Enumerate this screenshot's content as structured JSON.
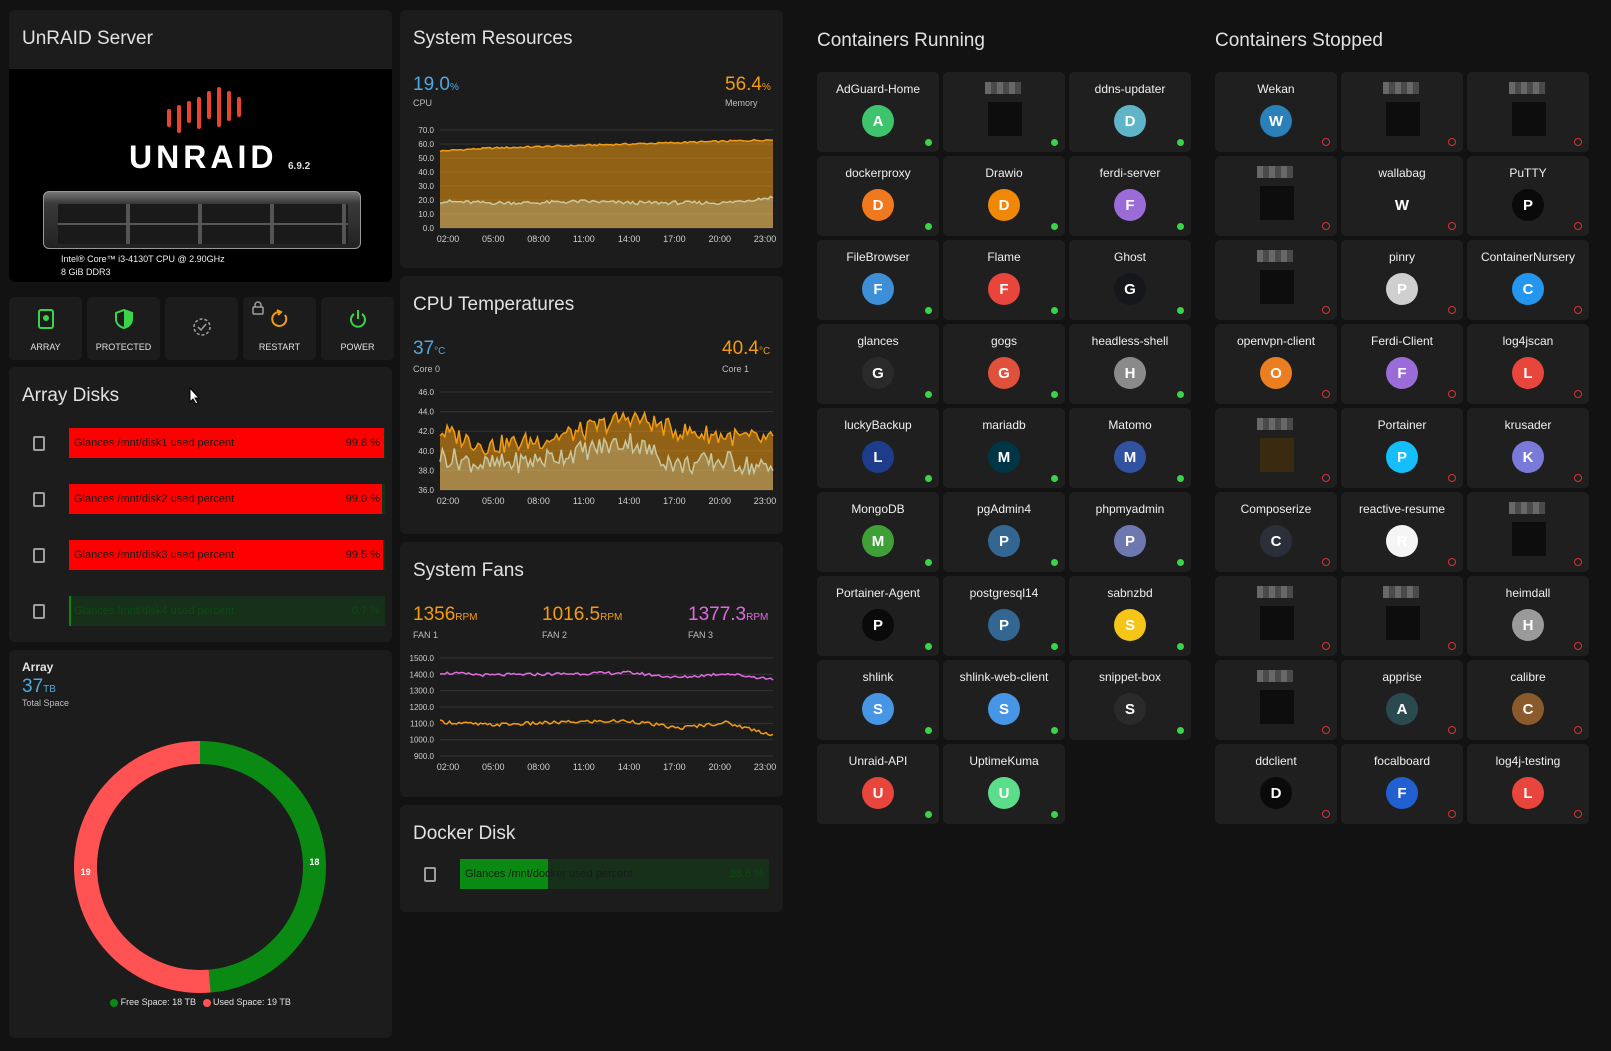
{
  "server": {
    "title": "UnRAID Server",
    "logo_text": "UNRAID",
    "version": "6.9.2",
    "cpu_info": "Intel® Core™ i3-4130T CPU @ 2.90GHz",
    "ram_info": "8 GiB DDR3"
  },
  "buttons": [
    {
      "label": "ARRAY",
      "icon": "array-icon",
      "color": "#3ad34a"
    },
    {
      "label": "PROTECTED",
      "icon": "shield-icon",
      "color": "#3ad34a"
    },
    {
      "label": "",
      "icon": "parity-check-icon",
      "color": "#9e9e9e"
    },
    {
      "label": "RESTART",
      "icon": "restart-icon",
      "color": "#f39c12"
    },
    {
      "label": "POWER",
      "icon": "power-icon",
      "color": "#3ad34a"
    }
  ],
  "array_disks": {
    "title": "Array Disks",
    "disks": [
      {
        "label": "Glances /mnt/disk1 used percent",
        "value": "99.8 %",
        "percent": 99.8
      },
      {
        "label": "Glances /mnt/disk2 used percent",
        "value": "99.0 %",
        "percent": 99.0
      },
      {
        "label": "Glances /mnt/disk3 used percent",
        "value": "99.5 %",
        "percent": 99.5
      },
      {
        "label": "Glances /mnt/disk4 used percent",
        "value": "0.7 %",
        "percent": 0.7
      }
    ]
  },
  "array_space": {
    "title": "Array",
    "total": "37",
    "unit": "TB",
    "sublabel": "Total Space",
    "legend_free": "Free Space: 18 TB",
    "legend_used": "Used Space: 19 TB"
  },
  "system_resources": {
    "title": "System Resources",
    "cpu_value": "19.0",
    "cpu_unit": "%",
    "cpu_label": "CPU",
    "mem_value": "56.4",
    "mem_unit": "%",
    "mem_label": "Memory"
  },
  "cpu_temps": {
    "title": "CPU Temperatures",
    "core0_value": "37",
    "core0_unit": "°C",
    "core0_label": "Core 0",
    "core1_value": "40.4",
    "core1_unit": "°C",
    "core1_label": "Core 1"
  },
  "fans": {
    "title": "System Fans",
    "fan1_value": "1356",
    "fan1_label": "FAN 1",
    "fan2_value": "1016.5",
    "fan2_label": "FAN 2",
    "fan3_value": "1377.3",
    "fan3_label": "FAN 3",
    "unit": "RPM"
  },
  "docker_disk": {
    "title": "Docker Disk",
    "label": "Glances /mnt/docker used percent",
    "value": "28.6 %",
    "percent": 28.6
  },
  "chart_data": [
    {
      "type": "area",
      "x": [
        "02:00",
        "05:00",
        "08:00",
        "11:00",
        "14:00",
        "17:00",
        "20:00",
        "23:00"
      ],
      "ylim": [
        0,
        70
      ],
      "yticks": [
        "70.0",
        "60.0",
        "50.0",
        "40.0",
        "30.0",
        "20.0",
        "10.0",
        "0.0"
      ],
      "series": [
        {
          "color": "#f39c12",
          "values": [
            55,
            57,
            58,
            59,
            60,
            61,
            62,
            63
          ]
        },
        {
          "color": "#c8c8a0",
          "values": [
            19,
            18,
            18,
            19,
            18,
            18,
            18,
            22
          ]
        }
      ]
    },
    {
      "type": "area",
      "x": [
        "02:00",
        "05:00",
        "08:00",
        "11:00",
        "14:00",
        "17:00",
        "20:00",
        "23:00"
      ],
      "ylim": [
        36,
        46
      ],
      "yticks": [
        "46.0",
        "44.0",
        "42.0",
        "40.0",
        "38.0",
        "36.0"
      ],
      "series": [
        {
          "color": "#f39c12",
          "values": [
            42,
            40.5,
            41,
            42,
            43.5,
            42,
            41.5,
            41
          ]
        },
        {
          "color": "#c8c8a0",
          "values": [
            39.5,
            38.5,
            39,
            40,
            41,
            38.5,
            39,
            38
          ]
        }
      ]
    },
    {
      "type": "line",
      "x": [
        "02:00",
        "05:00",
        "08:00",
        "11:00",
        "14:00",
        "17:00",
        "20:00",
        "23:00"
      ],
      "ylim": [
        900,
        1500
      ],
      "yticks": [
        "1500.0",
        "1400.0",
        "1300.0",
        "1200.0",
        "1100.0",
        "1000.0",
        "900.0"
      ],
      "series": [
        {
          "color": "#e06be0",
          "values": [
            1410,
            1395,
            1400,
            1405,
            1410,
            1380,
            1405,
            1370
          ]
        },
        {
          "color": "#f39c12",
          "values": [
            1110,
            1090,
            1100,
            1110,
            1115,
            1070,
            1105,
            1030
          ]
        }
      ]
    },
    {
      "type": "pie",
      "categories": [
        "Free Space",
        "Used Space"
      ],
      "values": [
        18,
        19
      ],
      "colors": [
        "#0a8a12",
        "#ff5252"
      ]
    }
  ],
  "running": {
    "title": "Containers Running",
    "items": [
      {
        "name": "AdGuard-Home",
        "icon": "adguard-icon",
        "color": "#3ec46d"
      },
      {
        "name": "",
        "icon": "redacted-icon",
        "color": "#0d0d0d",
        "redacted": true
      },
      {
        "name": "ddns-updater",
        "icon": "gopher-icon",
        "color": "#5fb4c8"
      },
      {
        "name": "dockerproxy",
        "icon": "plug-icon",
        "color": "#f0781e"
      },
      {
        "name": "Drawio",
        "icon": "drawio-icon",
        "color": "#f08705"
      },
      {
        "name": "ferdi-server",
        "icon": "cloud-icon",
        "color": "#9b6bd8"
      },
      {
        "name": "FileBrowser",
        "icon": "filebrowser-icon",
        "color": "#3d8fd8"
      },
      {
        "name": "Flame",
        "icon": "flame-icon",
        "color": "#e8453c"
      },
      {
        "name": "Ghost",
        "icon": "ghost-icon",
        "color": "#15171a"
      },
      {
        "name": "glances",
        "icon": "glances-icon",
        "color": "#2a2a2a"
      },
      {
        "name": "gogs",
        "icon": "gogs-icon",
        "color": "#e0503a"
      },
      {
        "name": "headless-shell",
        "icon": "chrome-icon",
        "color": "#8a8a8a"
      },
      {
        "name": "luckyBackup",
        "icon": "luckybackup-icon",
        "color": "#1e3c8c"
      },
      {
        "name": "mariadb",
        "icon": "mariadb-icon",
        "color": "#003545"
      },
      {
        "name": "Matomo",
        "icon": "matomo-icon",
        "color": "#3152a0"
      },
      {
        "name": "MongoDB",
        "icon": "mongodb-icon",
        "color": "#3fa037"
      },
      {
        "name": "pgAdmin4",
        "icon": "pgadmin-icon",
        "color": "#336791"
      },
      {
        "name": "phpmyadmin",
        "icon": "phpmyadmin-icon",
        "color": "#6c78af"
      },
      {
        "name": "Portainer-Agent",
        "icon": "portainer-agent-icon",
        "color": "#0a0a0a"
      },
      {
        "name": "postgresql14",
        "icon": "postgres-icon",
        "color": "#336791"
      },
      {
        "name": "sabnzbd",
        "icon": "sab-icon",
        "color": "#f5c518"
      },
      {
        "name": "shlink",
        "icon": "shlink-icon",
        "color": "#4696e5"
      },
      {
        "name": "shlink-web-client",
        "icon": "shlink-icon",
        "color": "#4696e5"
      },
      {
        "name": "snippet-box",
        "icon": "braces-icon",
        "color": "#2a2a2a"
      },
      {
        "name": "Unraid-API",
        "icon": "unraid-api-icon",
        "color": "#e8453c"
      },
      {
        "name": "UptimeKuma",
        "icon": "uptimekuma-icon",
        "color": "#5cdd8b"
      }
    ]
  },
  "stopped": {
    "title": "Containers Stopped",
    "items": [
      {
        "name": "Wekan",
        "icon": "wekan-icon",
        "color": "#2a80b9"
      },
      {
        "name": "",
        "icon": "redacted-icon",
        "color": "#0d0d0d",
        "redacted": true
      },
      {
        "name": "",
        "icon": "redacted-icon",
        "color": "#0d0d0d",
        "redacted": true
      },
      {
        "name": "",
        "icon": "redacted-icon",
        "color": "#0d0d0d",
        "redacted": true
      },
      {
        "name": "wallabag",
        "icon": "wallabag-icon",
        "color": "#1f1f1f"
      },
      {
        "name": "PuTTY",
        "icon": "putty-icon",
        "color": "#0a0a0a"
      },
      {
        "name": "",
        "icon": "redacted-icon",
        "color": "#0d0d0d",
        "redacted": true
      },
      {
        "name": "pinry",
        "icon": "pinry-icon",
        "color": "#cfcfcf"
      },
      {
        "name": "ContainerNursery",
        "icon": "docker-icon",
        "color": "#2496ed"
      },
      {
        "name": "openvpn-client",
        "icon": "openvpn-icon",
        "color": "#ea7e20"
      },
      {
        "name": "Ferdi-Client",
        "icon": "ferdi-icon",
        "color": "#9b6bd8"
      },
      {
        "name": "log4jscan",
        "icon": "log4jscan-icon",
        "color": "#e8453c"
      },
      {
        "name": "",
        "icon": "redacted-icon",
        "color": "#3a2a10",
        "redacted": true
      },
      {
        "name": "Portainer",
        "icon": "portainer-icon",
        "color": "#13bef9"
      },
      {
        "name": "krusader",
        "icon": "krusader-icon",
        "color": "#7a7ad8"
      },
      {
        "name": "Composerize",
        "icon": "composerize-icon",
        "color": "#2a2f3a"
      },
      {
        "name": "reactive-resume",
        "icon": "resume-icon",
        "color": "#f5f5f5"
      },
      {
        "name": "",
        "icon": "redacted-icon",
        "color": "#0d0d0d",
        "redacted": true
      },
      {
        "name": "",
        "icon": "redacted-icon",
        "color": "#0d0d0d",
        "redacted": true
      },
      {
        "name": "",
        "icon": "redacted-icon",
        "color": "#0d0d0d",
        "redacted": true
      },
      {
        "name": "heimdall",
        "icon": "heimdall-icon",
        "color": "#9a9a9a"
      },
      {
        "name": "",
        "icon": "redacted-icon",
        "color": "#0d0d0d",
        "redacted": true
      },
      {
        "name": "apprise",
        "icon": "apprise-icon",
        "color": "#2a4a50"
      },
      {
        "name": "calibre",
        "icon": "calibre-icon",
        "color": "#8b5a2b"
      },
      {
        "name": "ddclient",
        "icon": "moon-icon",
        "color": "#0a0a0a"
      },
      {
        "name": "focalboard",
        "icon": "focalboard-icon",
        "color": "#2060d0"
      },
      {
        "name": "log4j-testing",
        "icon": "alert-icon",
        "color": "#e8453c"
      }
    ]
  }
}
